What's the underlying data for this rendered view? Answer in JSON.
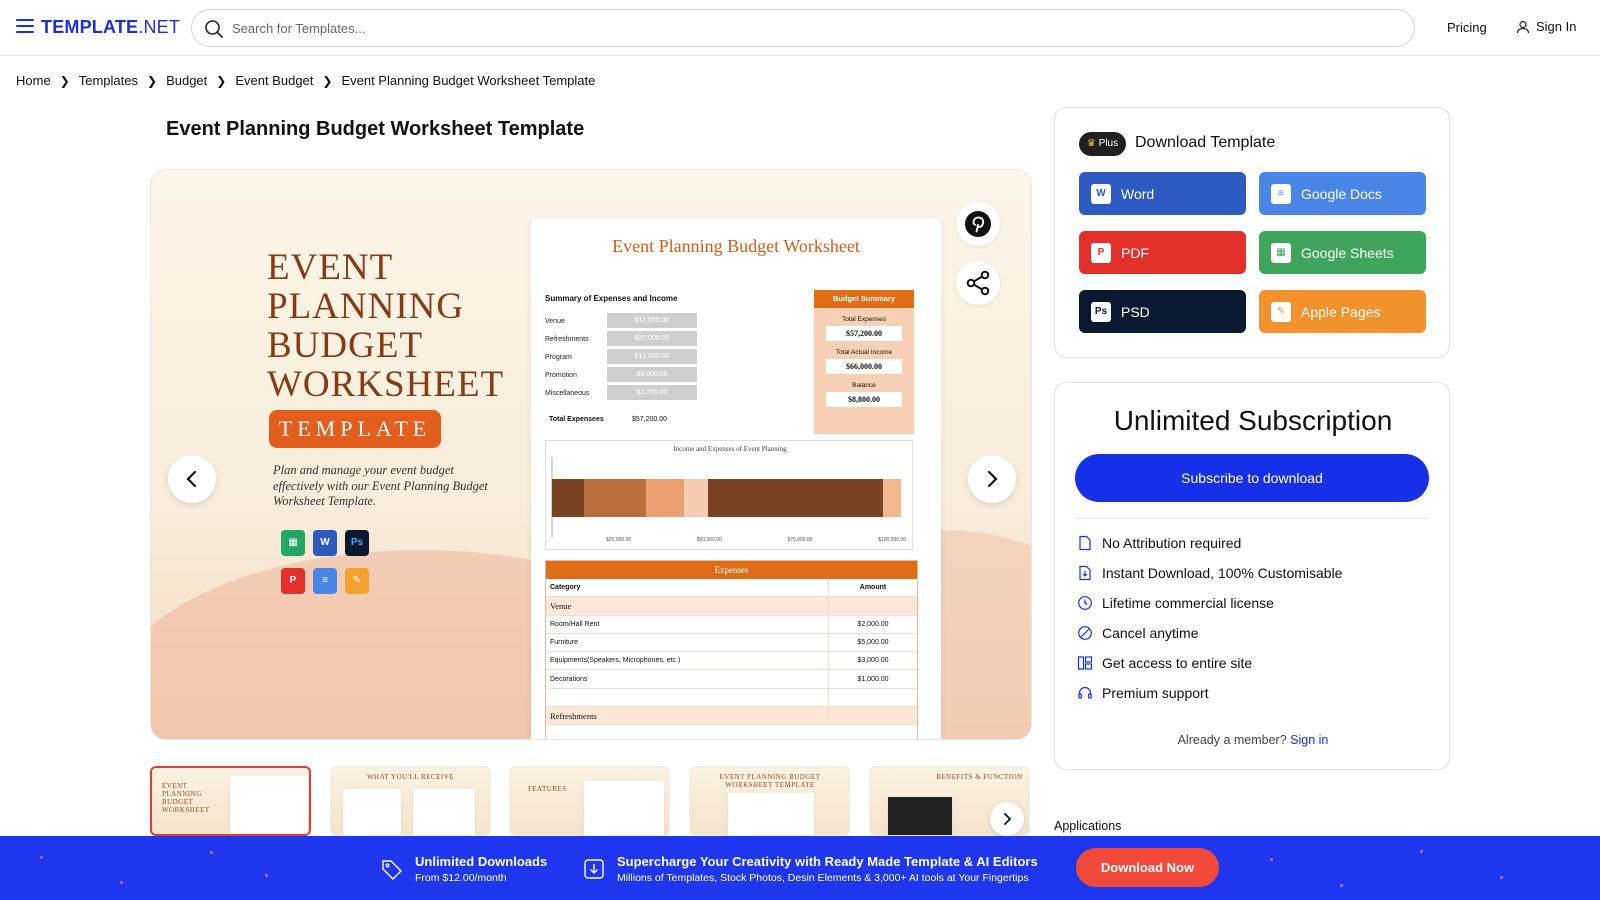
{
  "header": {
    "logo_bold": "TEMPLATE",
    "logo_suffix": ".NET",
    "search_placeholder": "Search for Templates...",
    "pricing": "Pricing",
    "signin": "Sign In"
  },
  "breadcrumb": [
    "Home",
    "Templates",
    "Budget",
    "Event Budget",
    "Event Planning Budget Worksheet Template"
  ],
  "page_title": "Event Planning Budget Worksheet Template",
  "preview": {
    "big_title_lines": [
      "EVENT",
      "PLANNING",
      "BUDGET",
      "WORKSHEET"
    ],
    "badge": "TEMPLATE",
    "description": "Plan and manage your event budget effectively with our Event Planning Budget Worksheet Template.",
    "sheet_title": "Event Planning Budget Worksheet",
    "summary_title": "Summary of Expenses and Income",
    "summary_rows": [
      {
        "label": "Venue",
        "value": "$11,000.00"
      },
      {
        "label": "Refreshments",
        "value": "$22,000.00"
      },
      {
        "label": "Program",
        "value": "$13,500.00"
      },
      {
        "label": "Promotion",
        "value": "$8,000.00"
      },
      {
        "label": "Miscellaneous",
        "value": "$2,700.00"
      }
    ],
    "total_label": "Total Expensees",
    "total_value": "$57,200.00",
    "budget_summary": {
      "header": "Budget Summary",
      "items": [
        {
          "label": "Total Expenses",
          "value": "$57,200.00"
        },
        {
          "label": "Total Actual Income",
          "value": "$66,000.00"
        },
        {
          "label": "Balance",
          "value": "$8,800.00"
        }
      ]
    },
    "chart_title": "Income and Expenses of Event Planning",
    "chart_ticks": [
      "$25,000.00",
      "$50,000.00",
      "$75,000.00",
      "$100,000.00"
    ],
    "expenses": {
      "header": "Expenses",
      "col_category": "Category",
      "col_amount": "Amount",
      "rows": [
        {
          "category": "Venue",
          "amount": "",
          "section": true
        },
        {
          "category": "Room/Hall Rent",
          "amount": "$2,000.00"
        },
        {
          "category": "Furniture",
          "amount": "$5,000.00"
        },
        {
          "category": "Equipments(Speakers, Microphones, etc.)",
          "amount": "$3,000.00"
        },
        {
          "category": "Decorations",
          "amount": "$1,000.00"
        },
        {
          "category": "",
          "amount": ""
        },
        {
          "category": "Refreshments",
          "amount": "",
          "section": true
        }
      ]
    }
  },
  "thumbnails": [
    {
      "label": "EVENT PLANNING BUDGET WORKSHEET",
      "active": true
    },
    {
      "label": "WHAT YOU'LL RECEIVE",
      "active": false
    },
    {
      "label": "FEATURES",
      "active": false
    },
    {
      "label": "EVENT PLANNING BUDGET WORKSHEET TEMPLATE",
      "active": false
    },
    {
      "label": "BENEFITS & FUNCTION",
      "active": false
    }
  ],
  "download": {
    "plus_badge": "Plus",
    "title": "Download Template",
    "buttons": [
      {
        "label": "Word",
        "color": "#2b5bbf",
        "icon": "word-icon",
        "glyph": "W"
      },
      {
        "label": "Google Docs",
        "color": "#4a86e8",
        "icon": "google-docs-icon",
        "glyph": "≡"
      },
      {
        "label": "PDF",
        "color": "#e3302a",
        "icon": "pdf-icon",
        "glyph": "P"
      },
      {
        "label": "Google Sheets",
        "color": "#3fa55c",
        "icon": "google-sheets-icon",
        "glyph": "▦"
      },
      {
        "label": "PSD",
        "color": "#0a1930",
        "icon": "psd-icon",
        "glyph": "Ps"
      },
      {
        "label": "Apple Pages",
        "color": "#f2922d",
        "icon": "apple-pages-icon",
        "glyph": "✎"
      }
    ]
  },
  "subscription": {
    "title": "Unlimited Subscription",
    "button": "Subscribe to download",
    "features": [
      "No Attribution required",
      "Instant Download, 100% Customisable",
      "Lifetime commercial license",
      "Cancel anytime",
      "Get access to entire site",
      "Premium support"
    ],
    "member_text": "Already a member?",
    "member_link": "Sign in"
  },
  "applications_label": "Applications",
  "banner": {
    "unlimited_title": "Unlimited Downloads",
    "unlimited_sub": "From $12.00/month",
    "promo_title": "Supercharge Your Creativity with Ready Made Template & AI Editors",
    "promo_sub": "Millions of Templates, Stock Photos, Desin Elements & 3,000+ AI tools at Your Fingertips",
    "button": "Download Now"
  },
  "colors": {
    "brand_blue": "#1d2fd6",
    "subscribe_blue": "#1630ea",
    "banner_blue": "#1d36ee",
    "download_red": "#f24a3a",
    "orange": "#e06c16"
  }
}
